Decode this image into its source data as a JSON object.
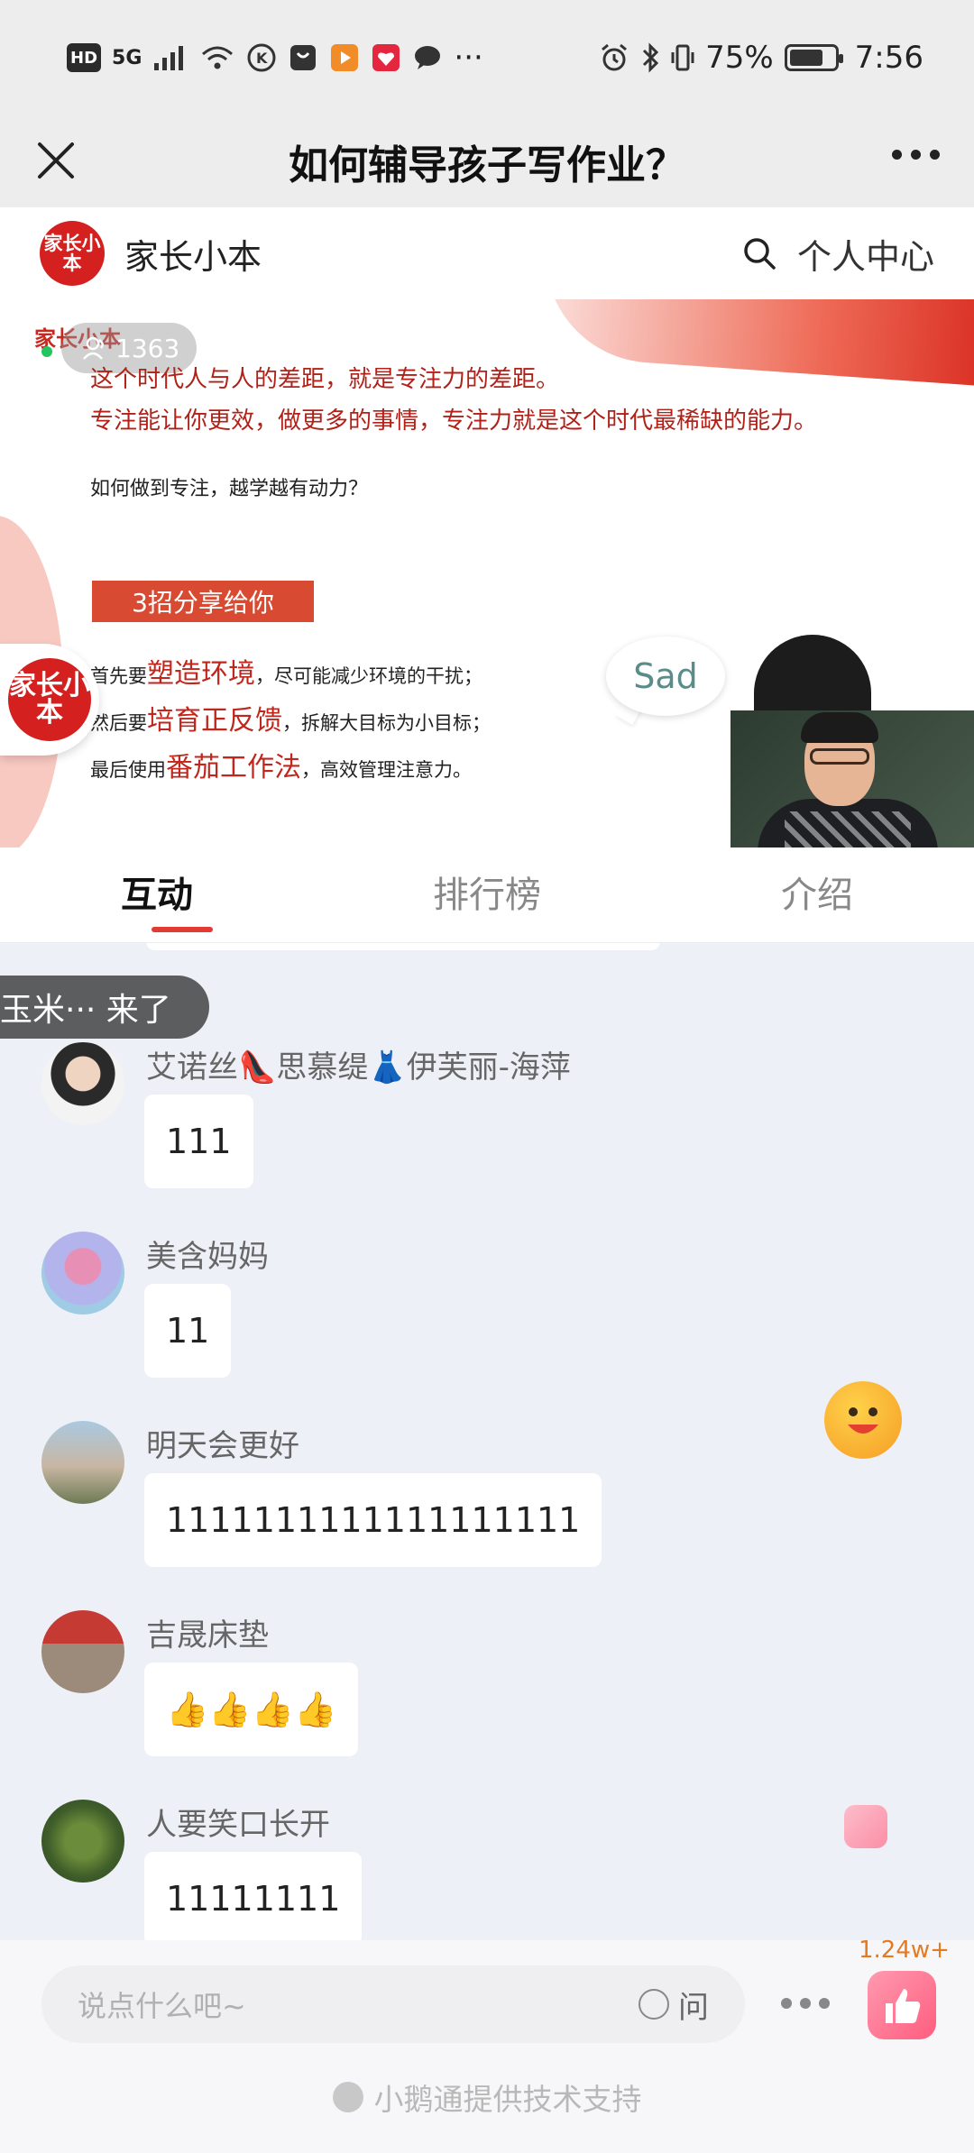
{
  "status_bar": {
    "network": "HD",
    "signal": "5G",
    "battery_percent": "75%",
    "time": "7:56",
    "overflow": "···",
    "battery_level": 0.75
  },
  "title_bar": {
    "title": "如何辅导孩子写作业？"
  },
  "channel": {
    "logo_text": "家长小本",
    "name": "家长小本",
    "personal_center": "个人中心",
    "brand_color": "#d4201e"
  },
  "video": {
    "slide_logo": "家长小本",
    "viewer_count": "1363",
    "lines": {
      "red1": "这个时代人与人的差距，就是专注力的差距。",
      "red2": "专注能让你更效，做更多的事情，专注力就是这个时代最稀缺的能力。",
      "q": "如何做到专注，越学越有动力？",
      "box": "3招分享给你",
      "l1_pre": "首先要",
      "l1_big": "塑造环境",
      "l1_post": "，尽可能减少环境的干扰；",
      "l2_pre": "然后要",
      "l2_big": "培育正反馈",
      "l2_post": "，拆解大目标为小目标；",
      "l3_pre": "最后使用",
      "l3_big": "番茄工作法",
      "l3_post": "，高效管理注意力。"
    },
    "sad_label": "Sad"
  },
  "tabs": [
    {
      "label": "互动",
      "active": true
    },
    {
      "label": "排行榜",
      "active": false
    },
    {
      "label": "介绍",
      "active": false
    }
  ],
  "toast": {
    "text": "玉米··· 来了"
  },
  "messages": [
    {
      "nickname": "艾诺丝👠思慕缇👗伊芙丽-海萍",
      "text": "111"
    },
    {
      "nickname": "美含妈妈",
      "text": "11"
    },
    {
      "nickname": "明天会更好",
      "text": "1111111111111111111"
    },
    {
      "nickname": "吉晟床垫",
      "text": "👍👍👍👍"
    },
    {
      "nickname": "人要笑口长开",
      "text": "11111111"
    }
  ],
  "bottom": {
    "input_placeholder": "说点什么吧~",
    "ask_label": "问",
    "like_count": "1.24w+",
    "powered_by": "小鹅通提供技术支持",
    "like_color": "#ff5d7e"
  }
}
